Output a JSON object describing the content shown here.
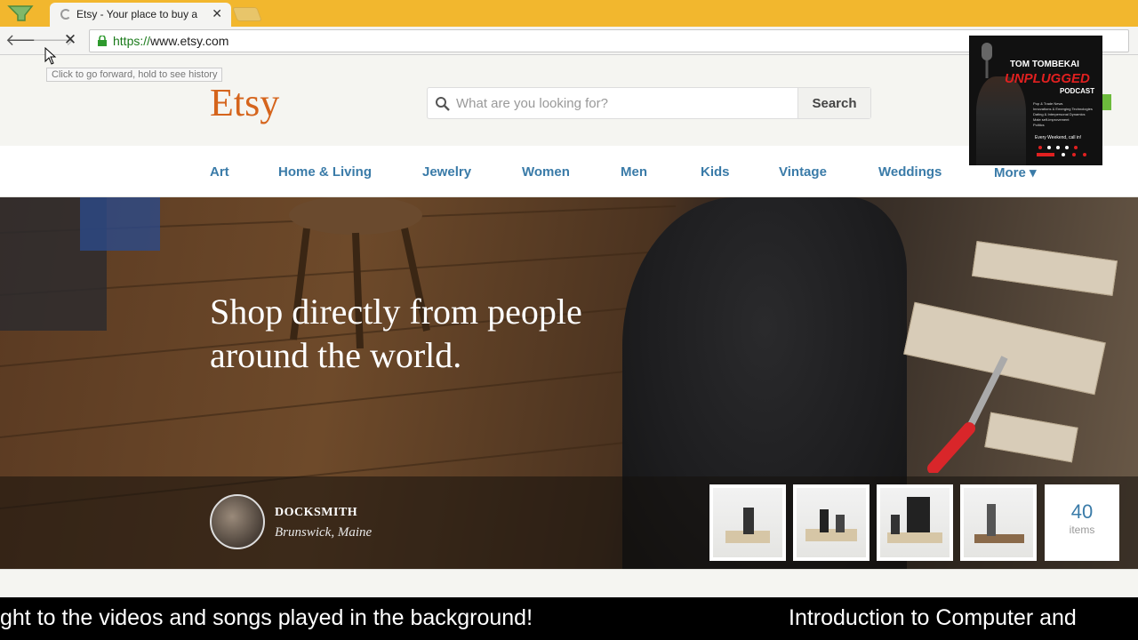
{
  "browser": {
    "tab_title": "Etsy - Your place to buy a",
    "url_scheme": "https://",
    "url_domain": "www.etsy.com",
    "url_full": "https://www.etsy.com",
    "tooltip": "Click to go forward, hold to see history"
  },
  "header": {
    "logo": "Etsy",
    "search_placeholder": "What are you looking for?",
    "search_button": "Search"
  },
  "categories": [
    "Art",
    "Home & Living",
    "Jewelry",
    "Women",
    "Men",
    "Kids",
    "Vintage",
    "Weddings",
    "More ▾"
  ],
  "hero": {
    "title": "Shop directly from people around the world.",
    "shop_name": "DOCKSMITH",
    "shop_location": "Brunswick, Maine",
    "item_count": "40",
    "item_count_label": "items"
  },
  "podcast": {
    "host": "TOM TOMBEKAI",
    "show": "UNPLUGGED",
    "type": "PODCAST",
    "topics": [
      "Pop & Trade News",
      "Innovations & Emerging Technologies",
      "Dating & Interpersonal Dynamics",
      "Male self-improvement",
      "Politics"
    ],
    "schedule": "Every Weekend, call in!"
  },
  "ticker": {
    "left": "ght to the videos and songs played in the background!",
    "right": "Introduction to Computer and"
  },
  "colors": {
    "chrome_tabstrip": "#f2b72e",
    "etsy_orange": "#d5641c",
    "link_blue": "#3a7ba8",
    "podcast_red": "#e02020"
  }
}
